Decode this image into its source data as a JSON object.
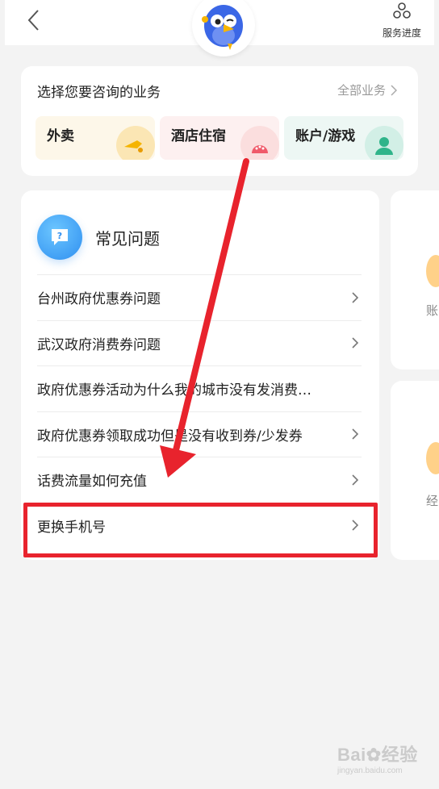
{
  "header": {
    "back_icon": "chevron-left-icon",
    "progress_label": "服务进度",
    "progress_icon": "nodes-icon"
  },
  "business": {
    "title": "选择您要咨询的业务",
    "all_label": "全部业务",
    "tiles": [
      {
        "label": "外卖",
        "color": "#fdf7e9"
      },
      {
        "label": "酒店住宿",
        "color": "#fdf0f0"
      },
      {
        "label": "账户/游戏",
        "color": "#edf7f4"
      }
    ]
  },
  "faq": {
    "title": "常见问题",
    "items": [
      "台州政府优惠券问题",
      "武汉政府消费券问题",
      "政府优惠券活动为什么我的城市没有发消费…",
      "政府优惠券领取成功但是没有收到券/少发券",
      "话费流量如何充值",
      "更换手机号"
    ]
  },
  "side_cards": [
    "账",
    "经"
  ],
  "watermark": {
    "brand": "Bai",
    "suffix": "经验",
    "sub": "jingyan.baidu.com"
  },
  "colors": {
    "accent_red": "#e8232d",
    "faq_blue": "#2f8ff0"
  }
}
